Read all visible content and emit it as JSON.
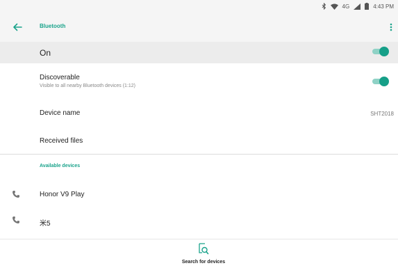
{
  "status_bar": {
    "network": "4G",
    "time": "4:43 PM"
  },
  "app_bar": {
    "title": "Bluetooth"
  },
  "bluetooth_toggle": {
    "label": "On",
    "enabled": true
  },
  "settings": {
    "discoverable": {
      "label": "Discoverable",
      "subtitle": "Visible to all nearby Bluetooth devices (1:12)",
      "enabled": true
    },
    "device_name": {
      "label": "Device name",
      "value": "SHT2018"
    },
    "received_files": {
      "label": "Received files"
    }
  },
  "available_devices": {
    "header": "Available devices",
    "items": [
      {
        "name": "Honor V9 Play",
        "icon": "phone-icon"
      },
      {
        "name": "米5",
        "icon": "phone-icon"
      }
    ]
  },
  "footer": {
    "search_label": "Search for devices"
  },
  "colors": {
    "accent": "#1aa38b",
    "toggle_track": "#8fd2c6",
    "toggle_thumb": "#169f88",
    "header_bg": "#f5f5f5",
    "selected_row_bg": "#ececec"
  }
}
